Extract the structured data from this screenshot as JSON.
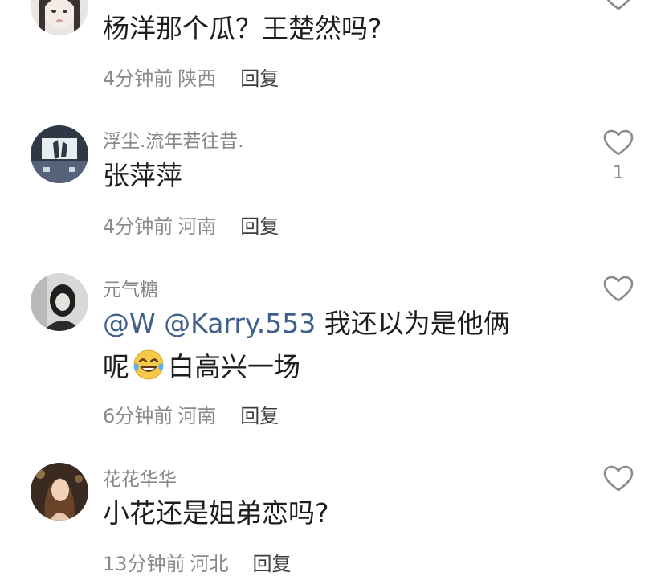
{
  "comments": [
    {
      "text": "杨洋那个瓜？王楚然吗?",
      "time": "4分钟前",
      "location": "陕西",
      "reply_label": "回复"
    },
    {
      "username": "浮尘.流年若往昔.",
      "text": "张萍萍",
      "time": "4分钟前",
      "location": "河南",
      "reply_label": "回复",
      "likes": "1"
    },
    {
      "username": "元气糖",
      "mention1": "@W",
      "mention2": "@Karry.553",
      "text_line1": "我还以为是他俩",
      "text_line2_a": "呢",
      "emoji": "face-with-tears-of-joy",
      "text_line2_b": "白高兴一场",
      "time": "6分钟前",
      "location": "河南",
      "reply_label": "回复"
    },
    {
      "username": "花花华华",
      "text": "小花还是姐弟恋吗?",
      "time": "13分钟前",
      "location": "河北",
      "reply_label": "回复"
    }
  ],
  "colors": {
    "mention": "#3f5f8c",
    "meta": "#8a8a8e",
    "username": "#86868b"
  }
}
